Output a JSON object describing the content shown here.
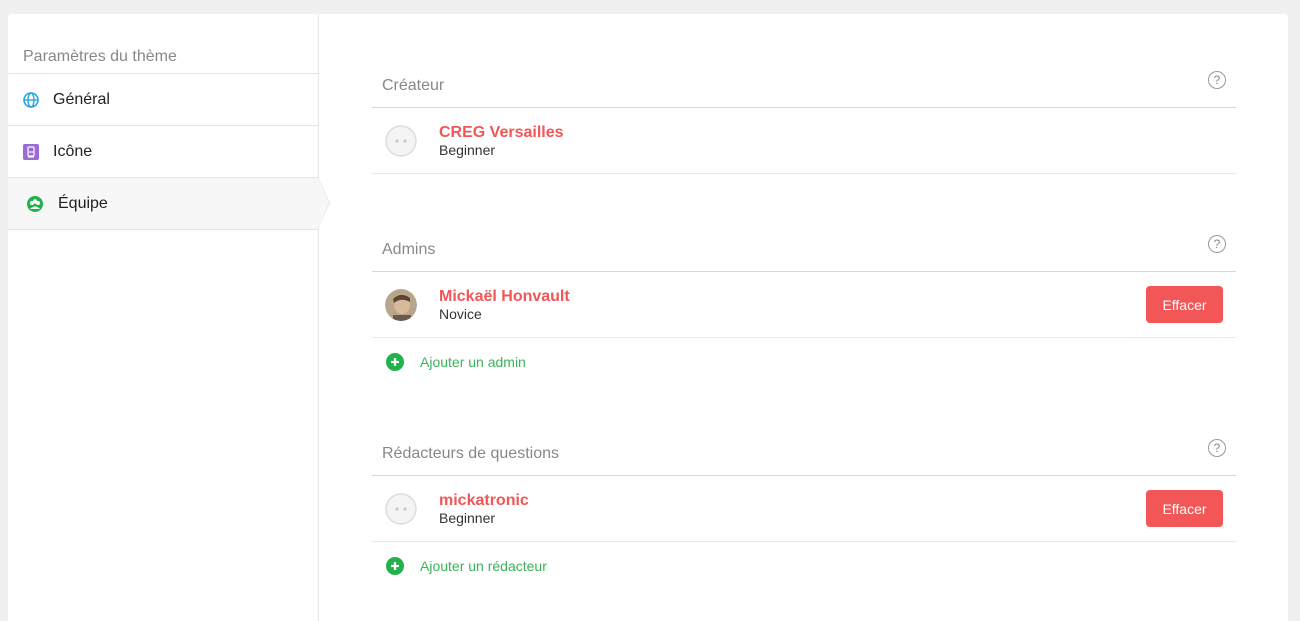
{
  "sidebar": {
    "title": "Paramètres du thème",
    "items": [
      {
        "label": "Général",
        "icon": "globe-icon",
        "color": "#2aa5d8"
      },
      {
        "label": "Icône",
        "icon": "image-icon",
        "color": "#9b6bd6"
      },
      {
        "label": "Équipe",
        "icon": "team-icon",
        "color": "#22b24c"
      }
    ]
  },
  "sections": {
    "creator": {
      "title": "Créateur",
      "members": [
        {
          "name": "CREG Versailles",
          "level": "Beginner"
        }
      ]
    },
    "admins": {
      "title": "Admins",
      "members": [
        {
          "name": "Mickaël Honvault",
          "level": "Novice",
          "delete_label": "Effacer"
        }
      ],
      "add_label": "Ajouter un admin"
    },
    "editors": {
      "title": "Rédacteurs de questions",
      "members": [
        {
          "name": "mickatronic",
          "level": "Beginner",
          "delete_label": "Effacer"
        }
      ],
      "add_label": "Ajouter un rédacteur"
    }
  },
  "colors": {
    "accent": "#f25656",
    "add": "#22b24c",
    "bg": "#f0f0f0"
  }
}
